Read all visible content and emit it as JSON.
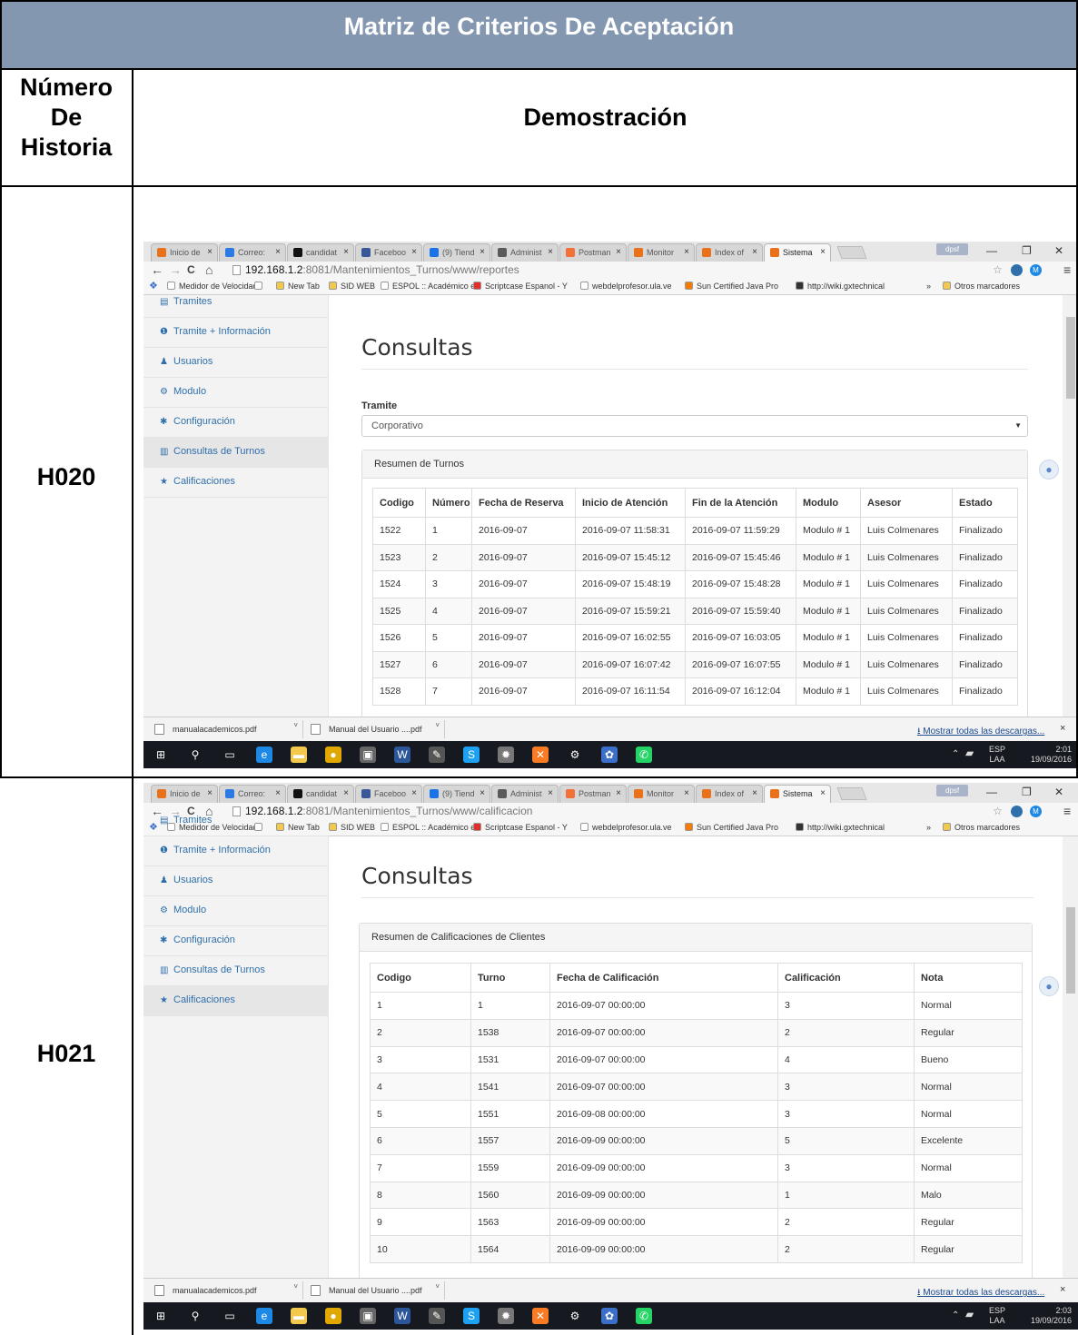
{
  "document": {
    "title": "Matriz de Criterios De Aceptación",
    "col_number_header": "Número\nDe\nHistoria",
    "col_demo_header": "Demostración",
    "rows": [
      "H020",
      "H021"
    ]
  },
  "colors": {
    "header_bg": "#8497b0",
    "link_blue": "#2f6fab",
    "taskbar": "#16191f"
  },
  "browser": {
    "tabs": [
      "Inicio de",
      "Correo:",
      "candidat",
      "Faceboo",
      "(9) Tiend",
      "Administ",
      "Postman",
      "Monitor",
      "Index of",
      "Sistema"
    ],
    "tab_close": "×",
    "profile": "dpsf",
    "window_controls": [
      "—",
      "❐",
      "✕"
    ],
    "nav_back": "←",
    "nav_forward": "→",
    "nav_reload": "C",
    "nav_home": "⌂",
    "url_host": "192.168.1.2",
    "bookmarks": [
      "Medidor de Velocidad",
      "",
      "New Tab",
      "SID WEB",
      "ESPOL :: Académico e",
      "Scriptcase Espanol - Y",
      "webdelprofesor.ula.ve",
      "Sun Certified Java Pro",
      "http://wiki.gxtechnical",
      "»",
      "Otros marcadores"
    ]
  },
  "shot1": {
    "url_rest": ":8081/Mantenimientos_Turnos/www/reportes",
    "sidebar": [
      {
        "icon": "▤",
        "label": "Tramites"
      },
      {
        "icon": "❶",
        "label": "Tramite + Información"
      },
      {
        "icon": "♟",
        "label": "Usuarios"
      },
      {
        "icon": "⚙",
        "label": "Modulo"
      },
      {
        "icon": "✱",
        "label": "Configuración"
      },
      {
        "icon": "▥",
        "label": "Consultas de Turnos"
      },
      {
        "icon": "★",
        "label": "Calificaciones"
      }
    ],
    "page_title": "Consultas",
    "tramite_label": "Tramite",
    "tramite_value": "Corporativo",
    "panel_title": "Resumen de Turnos",
    "columns": [
      "Codigo",
      "Número",
      "Fecha de Reserva",
      "Inicio de Atención",
      "Fin de la Atención",
      "Modulo",
      "Asesor",
      "Estado"
    ],
    "rows": [
      [
        "1522",
        "1",
        "2016-09-07",
        "2016-09-07 11:58:31",
        "2016-09-07 11:59:29",
        "Modulo # 1",
        "Luis Colmenares",
        "Finalizado"
      ],
      [
        "1523",
        "2",
        "2016-09-07",
        "2016-09-07 15:45:12",
        "2016-09-07 15:45:46",
        "Modulo # 1",
        "Luis Colmenares",
        "Finalizado"
      ],
      [
        "1524",
        "3",
        "2016-09-07",
        "2016-09-07 15:48:19",
        "2016-09-07 15:48:28",
        "Modulo # 1",
        "Luis Colmenares",
        "Finalizado"
      ],
      [
        "1525",
        "4",
        "2016-09-07",
        "2016-09-07 15:59:21",
        "2016-09-07 15:59:40",
        "Modulo # 1",
        "Luis Colmenares",
        "Finalizado"
      ],
      [
        "1526",
        "5",
        "2016-09-07",
        "2016-09-07 16:02:55",
        "2016-09-07 16:03:05",
        "Modulo # 1",
        "Luis Colmenares",
        "Finalizado"
      ],
      [
        "1527",
        "6",
        "2016-09-07",
        "2016-09-07 16:07:42",
        "2016-09-07 16:07:55",
        "Modulo # 1",
        "Luis Colmenares",
        "Finalizado"
      ],
      [
        "1528",
        "7",
        "2016-09-07",
        "2016-09-07 16:11:54",
        "2016-09-07 16:12:04",
        "Modulo # 1",
        "Luis Colmenares",
        "Finalizado"
      ]
    ],
    "downloads": [
      "manualacademicos.pdf",
      "Manual del Usuario ....pdf"
    ],
    "show_all": "Mostrar todas las descargas...",
    "lang": "ESP",
    "layout": "LAA",
    "time": "2:01",
    "date": "19/09/2016"
  },
  "shot2": {
    "url_rest": ":8081/Mantenimientos_Turnos/www/calificacion",
    "sidebar": [
      {
        "icon": "▤",
        "label": "Tramites"
      },
      {
        "icon": "❶",
        "label": "Tramite + Información"
      },
      {
        "icon": "♟",
        "label": "Usuarios"
      },
      {
        "icon": "⚙",
        "label": "Modulo"
      },
      {
        "icon": "✱",
        "label": "Configuración"
      },
      {
        "icon": "▥",
        "label": "Consultas de Turnos"
      },
      {
        "icon": "★",
        "label": "Calificaciones"
      }
    ],
    "page_title": "Consultas",
    "panel_title": "Resumen de Calificaciones de Clientes",
    "columns": [
      "Codigo",
      "Turno",
      "Fecha de Calificación",
      "Calificación",
      "Nota"
    ],
    "rows": [
      [
        "1",
        "1",
        "2016-09-07 00:00:00",
        "3",
        "Normal"
      ],
      [
        "2",
        "1538",
        "2016-09-07 00:00:00",
        "2",
        "Regular"
      ],
      [
        "3",
        "1531",
        "2016-09-07 00:00:00",
        "4",
        "Bueno"
      ],
      [
        "4",
        "1541",
        "2016-09-07 00:00:00",
        "3",
        "Normal"
      ],
      [
        "5",
        "1551",
        "2016-09-08 00:00:00",
        "3",
        "Normal"
      ],
      [
        "6",
        "1557",
        "2016-09-09 00:00:00",
        "5",
        "Excelente"
      ],
      [
        "7",
        "1559",
        "2016-09-09 00:00:00",
        "3",
        "Normal"
      ],
      [
        "8",
        "1560",
        "2016-09-09 00:00:00",
        "1",
        "Malo"
      ],
      [
        "9",
        "1563",
        "2016-09-09 00:00:00",
        "2",
        "Regular"
      ],
      [
        "10",
        "1564",
        "2016-09-09 00:00:00",
        "2",
        "Regular"
      ]
    ],
    "downloads": [
      "manualacademicos.pdf",
      "Manual del Usuario ....pdf"
    ],
    "show_all": "Mostrar todas las descargas...",
    "lang": "ESP",
    "layout": "LAA",
    "time": "2:03",
    "date": "19/09/2016"
  }
}
